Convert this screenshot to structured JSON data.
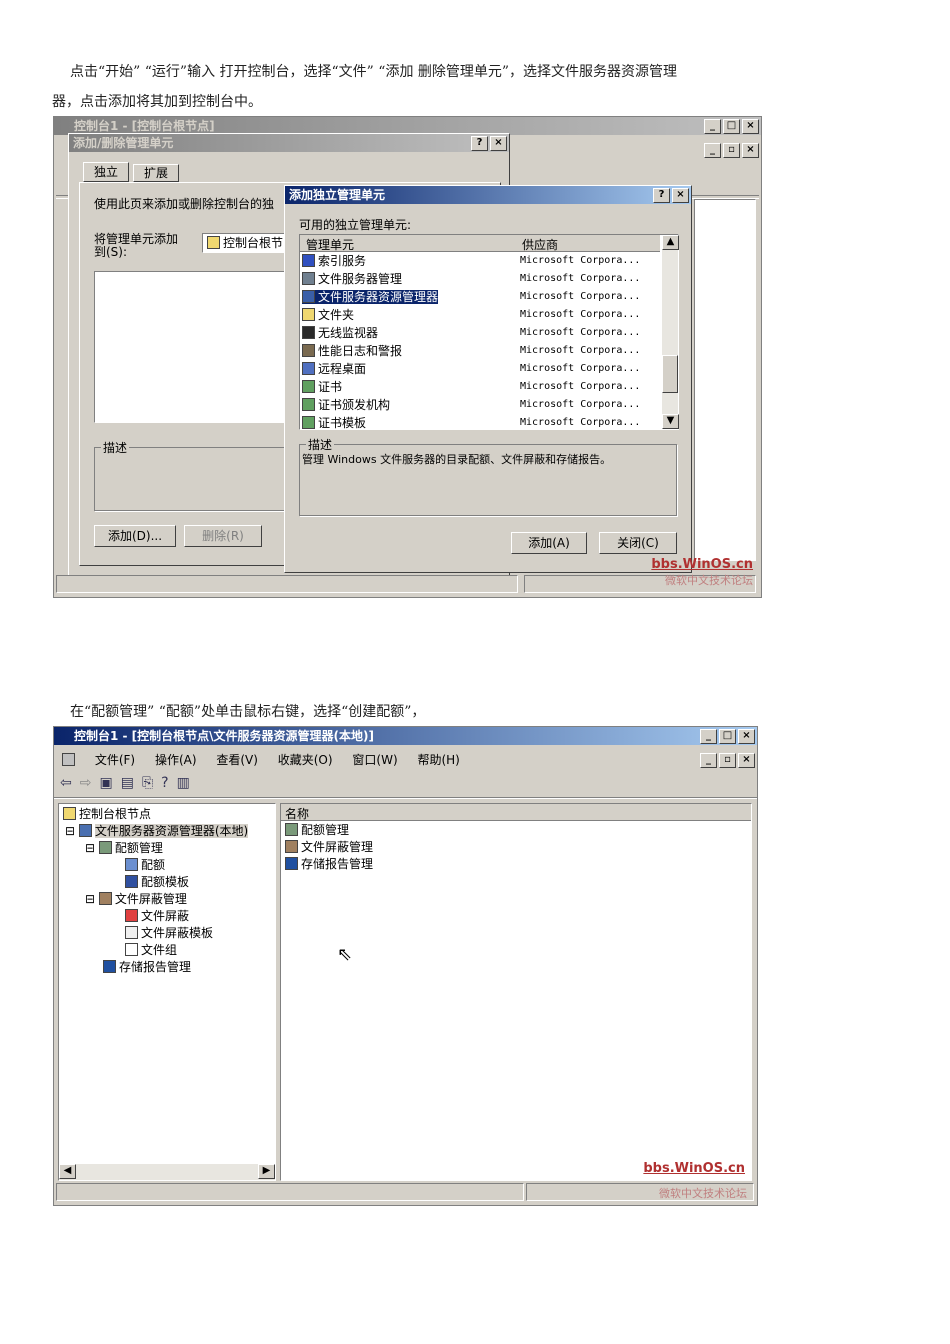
{
  "doc": {
    "para1_line1": "点击“开始” “运行”输入 打开控制台，选择“文件” “添加 删除管理单元”，选择文件服务器资源管理",
    "para1_line2": "器，点击添加将其加到控制台中。",
    "para2": "在“配额管理” “配额”处单击鼠标右键，选择“创建配额”，"
  },
  "shot1": {
    "main_title": "控制台1 - [控制台根节点]",
    "addremove": {
      "title": "添加/删除管理单元",
      "tab_standalone": "独立",
      "tab_extension": "扩展",
      "intro": "使用此页来添加或删除控制台的独",
      "addto_label": "将管理单元添加到(S):",
      "addto_value": "控制台根节",
      "desc_label": "描述",
      "btn_add": "添加(D)...",
      "btn_remove": "删除(R)"
    },
    "standalone": {
      "title": "添加独立管理单元",
      "available_label": "可用的独立管理单元:",
      "col_snapin": "管理单元",
      "col_vendor": "供应商",
      "items": [
        {
          "name": "索引服务",
          "vendor": "Microsoft Corpora...",
          "icon": "index-icon"
        },
        {
          "name": "文件服务器管理",
          "vendor": "Microsoft Corpora...",
          "icon": "server-icon"
        },
        {
          "name": "文件服务器资源管理器",
          "vendor": "Microsoft Corpora...",
          "icon": "fsrm-icon"
        },
        {
          "name": "文件夹",
          "vendor": "Microsoft Corpora...",
          "icon": "folder-icon"
        },
        {
          "name": "无线监视器",
          "vendor": "Microsoft Corpora...",
          "icon": "antenna-icon"
        },
        {
          "name": "性能日志和警报",
          "vendor": "Microsoft Corpora...",
          "icon": "perf-icon"
        },
        {
          "name": "远程桌面",
          "vendor": "Microsoft Corpora...",
          "icon": "remote-icon"
        },
        {
          "name": "证书",
          "vendor": "Microsoft Corpora...",
          "icon": "cert-icon"
        },
        {
          "name": "证书颁发机构",
          "vendor": "Microsoft Corpora...",
          "icon": "ca-icon"
        },
        {
          "name": "证书模板",
          "vendor": "Microsoft Corpora...",
          "icon": "template-icon"
        }
      ],
      "selected_index": 2,
      "desc_label": "描述",
      "desc_text": "管理 Windows 文件服务器的目录配额、文件屏蔽和存储报告。",
      "btn_add": "添加(A)",
      "btn_close": "关闭(C)"
    },
    "wm_url": "bbs.WinOS.cn",
    "wm_name": "微软中文技术论坛"
  },
  "shot2": {
    "title": "控制台1 - [控制台根节点\\文件服务器资源管理器(本地)]",
    "menu": [
      "文件(F)",
      "操作(A)",
      "查看(V)",
      "收藏夹(O)",
      "窗口(W)",
      "帮助(H)"
    ],
    "tree": {
      "root": "控制台根节点",
      "fsrm": "文件服务器资源管理器(本地)",
      "quota_mgmt": "配额管理",
      "quota": "配额",
      "quota_template": "配额模板",
      "screen_mgmt": "文件屏蔽管理",
      "screen": "文件屏蔽",
      "screen_template": "文件屏蔽模板",
      "file_group": "文件组",
      "storage_report": "存储报告管理"
    },
    "list_header": "名称",
    "list_items": [
      "配额管理",
      "文件屏蔽管理",
      "存储报告管理"
    ],
    "wm_url": "bbs.WinOS.cn",
    "wm_name": "微软中文技术论坛"
  }
}
